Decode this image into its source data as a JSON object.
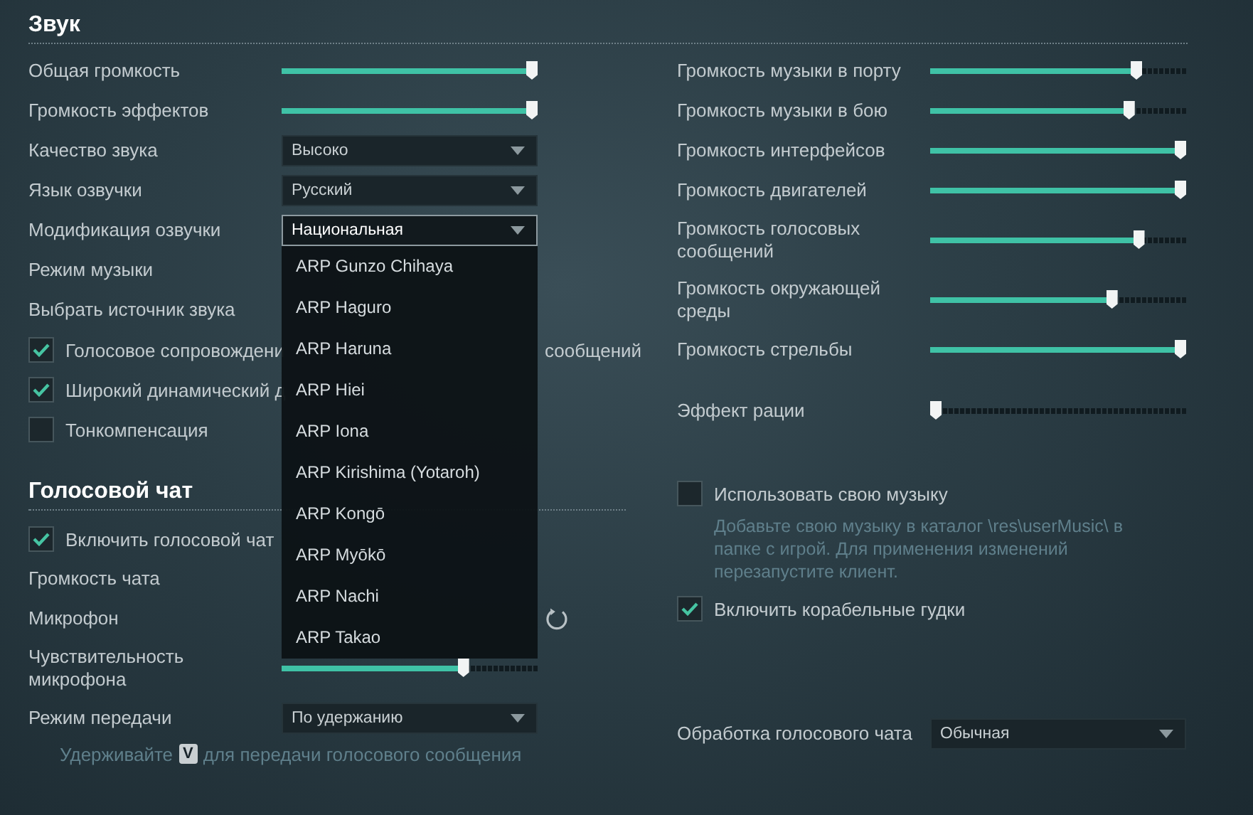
{
  "sound": {
    "title": "Звук",
    "rows": [
      {
        "kind": "slider",
        "label": "Общая громкость",
        "level": 1
      },
      {
        "kind": "slider",
        "label": "Громкость эффектов",
        "level": 1
      },
      {
        "kind": "select",
        "label": "Качество звука",
        "value": "Высоко",
        "expanded": false
      },
      {
        "kind": "select",
        "label": "Язык озвучки",
        "value": "Русский",
        "expanded": false
      },
      {
        "kind": "select",
        "label": "Модификация озвучки",
        "value": "Национальная",
        "expanded": true,
        "options": [
          "ARP Gunzo Chihaya",
          "ARP Haguro",
          "ARP Haruna",
          "ARP Hiei",
          "ARP Iona",
          "ARP Kirishima (Yotaroh)",
          "ARP Kongō",
          "ARP Myōkō",
          "ARP Nachi",
          "ARP Takao"
        ]
      },
      {
        "kind": "label",
        "label": "Режим музыки"
      },
      {
        "kind": "label",
        "label": "Выбрать источник звука"
      },
      {
        "kind": "checkbox",
        "label": "Голосовое сопровождени",
        "checked": true,
        "tail": "сообщений"
      },
      {
        "kind": "checkbox",
        "label": "Широкий динамический д",
        "checked": true
      },
      {
        "kind": "checkbox",
        "label": "Тонкомпенсация",
        "checked": false
      }
    ]
  },
  "voice_chat": {
    "title": "Голосовой чат",
    "rows": [
      {
        "kind": "checkbox",
        "label": "Включить голосовой чат",
        "checked": true
      },
      {
        "kind": "label",
        "label": "Громкость чата"
      },
      {
        "kind": "refresh",
        "label": "Микрофон"
      },
      {
        "kind": "slider",
        "label": "Чувствительность микрофона",
        "level": 0.72
      },
      {
        "kind": "select",
        "label": "Режим передачи",
        "value": "По удержанию",
        "expanded": false
      },
      {
        "kind": "hint",
        "before": "Удерживайте",
        "key": "V",
        "after": "для передачи голосового сообщения"
      }
    ]
  },
  "right_groups": [
    [
      {
        "kind": "slider",
        "label": "Громкость музыки в порту",
        "level": 0.82
      },
      {
        "kind": "slider",
        "label": "Громкость музыки в бою",
        "level": 0.79
      },
      {
        "kind": "slider",
        "label": "Громкость интерфейсов",
        "level": 1
      },
      {
        "kind": "slider",
        "label": "Громкость двигателей",
        "level": 1
      },
      {
        "kind": "slider",
        "label": "Громкость голосовых сообщений",
        "level": 0.83
      },
      {
        "kind": "slider",
        "label": "Громкость окружающей среды",
        "level": 0.72
      },
      {
        "kind": "slider",
        "label": "Громкость стрельбы",
        "level": 1
      }
    ],
    [
      {
        "kind": "slider",
        "label": "Эффект рации",
        "level": 0
      }
    ],
    [
      {
        "kind": "checkbox",
        "label": "Использовать свою музыку",
        "checked": false
      },
      {
        "kind": "note",
        "text": "Добавьте свою музыку в каталог \\res\\userMusic\\ в папке с игрой. Для применения изменений перезапустите клиент."
      },
      {
        "kind": "checkbox",
        "label": "Включить корабельные гудки",
        "checked": true
      }
    ],
    [
      {
        "kind": "select",
        "label": "Обработка голосового чата",
        "value": "Обычная",
        "expanded": false
      }
    ]
  ]
}
